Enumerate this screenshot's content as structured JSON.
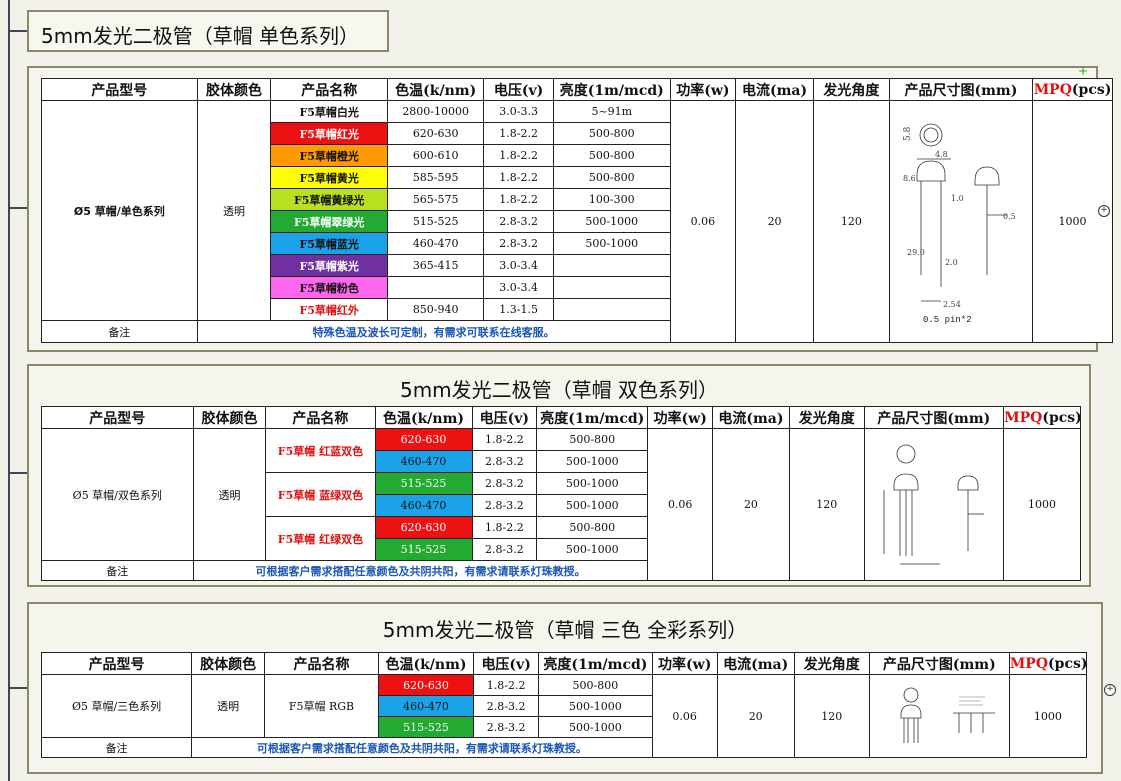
{
  "header_title": "5mm发光二极管（草帽 单色系列）",
  "headers": {
    "model": "产品型号",
    "color": "胶体颜色",
    "name": "产品名称",
    "temp": "色温(k/nm)",
    "volt": "电压(v)",
    "bright": "亮度(1m/mcd)",
    "power": "功率(w)",
    "current": "电流(ma)",
    "angle": "发光角度",
    "dim": "产品尺寸图(mm)",
    "mpq_red": "MPQ",
    "mpq_black": "(pcs)"
  },
  "panel1": {
    "model": "Ø5 草帽/单色系列",
    "color": "透明",
    "rows": [
      {
        "name": "F5草帽白光",
        "temp": "2800-10000",
        "volt": "3.0-3.3",
        "bright": "5~91m"
      },
      {
        "name": "F5草帽红光",
        "temp": "620-630",
        "volt": "1.8-2.2",
        "bright": "500-800"
      },
      {
        "name": "F5草帽橙光",
        "temp": "600-610",
        "volt": "1.8-2.2",
        "bright": "500-800"
      },
      {
        "name": "F5草帽黄光",
        "temp": "585-595",
        "volt": "1.8-2.2",
        "bright": "500-800"
      },
      {
        "name": "F5草帽黄绿光",
        "temp": "565-575",
        "volt": "1.8-2.2",
        "bright": "100-300"
      },
      {
        "name": "F5草帽翠绿光",
        "temp": "515-525",
        "volt": "2.8-3.2",
        "bright": "500-1000"
      },
      {
        "name": "F5草帽蓝光",
        "temp": "460-470",
        "volt": "2.8-3.2",
        "bright": "500-1000"
      },
      {
        "name": "F5草帽紫光",
        "temp": "365-415",
        "volt": "3.0-3.4",
        "bright": ""
      },
      {
        "name": "F5草帽粉色",
        "temp": "",
        "volt": "3.0-3.4",
        "bright": ""
      },
      {
        "name": "F5草帽红外",
        "temp": "850-940",
        "volt": "1.3-1.5",
        "bright": ""
      }
    ],
    "row_colors": [
      "#ffffff",
      "#ee1111",
      "#ff9a00",
      "#ffff00",
      "#b8e020",
      "#22aa33",
      "#1aa3e8",
      "#7030a0",
      "#ff66ee",
      "#ffffff"
    ],
    "row_text_colors": [
      "#111111",
      "#ffffff",
      "#111111",
      "#111111",
      "#111111",
      "#ffffff",
      "#111111",
      "#ffffff",
      "#111111",
      "#e01010"
    ],
    "power": "0.06",
    "current": "20",
    "angle": "120",
    "mpq": "1000",
    "note_label": "备注",
    "note": "特殊色温及波长可定制，有需求可联系在线客服。",
    "dim_labels": {
      "top": "5.8",
      "w": "4.8",
      "h": "8.6",
      "s": "1.0",
      "l": "29.0",
      "b": "2.0",
      "p": "2.54",
      "side": "0.5",
      "pin": "0.5 pin*2"
    }
  },
  "panel2": {
    "title": "5mm发光二极管（草帽 双色系列）",
    "model": "Ø5 草帽/双色系列",
    "color": "透明",
    "groups": [
      {
        "name": "F5草帽  红蓝双色",
        "rows": [
          {
            "temp": "620-630",
            "volt": "1.8-2.2",
            "bright": "500-800",
            "bg": "#ee1111",
            "fg": "#ffffff"
          },
          {
            "temp": "460-470",
            "volt": "2.8-3.2",
            "bright": "500-1000",
            "bg": "#1aa3e8",
            "fg": "#111111"
          }
        ]
      },
      {
        "name": "F5草帽  蓝绿双色",
        "rows": [
          {
            "temp": "515-525",
            "volt": "2.8-3.2",
            "bright": "500-1000",
            "bg": "#22aa33",
            "fg": "#ffffff"
          },
          {
            "temp": "460-470",
            "volt": "2.8-3.2",
            "bright": "500-1000",
            "bg": "#1aa3e8",
            "fg": "#111111"
          }
        ]
      },
      {
        "name": "F5草帽  红绿双色",
        "rows": [
          {
            "temp": "620-630",
            "volt": "1.8-2.2",
            "bright": "500-800",
            "bg": "#ee1111",
            "fg": "#ffffff"
          },
          {
            "temp": "515-525",
            "volt": "2.8-3.2",
            "bright": "500-1000",
            "bg": "#22aa33",
            "fg": "#ffffff"
          }
        ]
      }
    ],
    "power": "0.06",
    "current": "20",
    "angle": "120",
    "mpq": "1000",
    "note_label": "备注",
    "note": "可根据客户需求搭配任意颜色及共阴共阳，有需求请联系灯珠教授。"
  },
  "panel3": {
    "title": "5mm发光二极管（草帽 三色 全彩系列）",
    "model": "Ø5 草帽/三色系列",
    "color": "透明",
    "name": "F5草帽 RGB",
    "rows": [
      {
        "temp": "620-630",
        "volt": "1.8-2.2",
        "bright": "500-800",
        "bg": "#ee1111",
        "fg": "#ffffff"
      },
      {
        "temp": "460-470",
        "volt": "2.8-3.2",
        "bright": "500-1000",
        "bg": "#1aa3e8",
        "fg": "#111111"
      },
      {
        "temp": "515-525",
        "volt": "2.8-3.2",
        "bright": "500-1000",
        "bg": "#22aa33",
        "fg": "#ffffff"
      }
    ],
    "power": "0.06",
    "current": "20",
    "angle": "120",
    "mpq": "1000",
    "note_label": "备注",
    "note": "可根据客户需求搭配任意颜色及共阴共阳，有需求请联系灯珠教授。"
  }
}
